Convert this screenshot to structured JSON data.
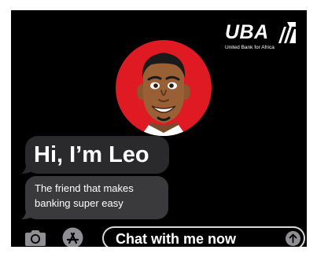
{
  "brand": {
    "name": "UBA",
    "tagline": "United Bank for Africa"
  },
  "messages": {
    "greeting": "Hi, I’m Leo",
    "subtext_line1": "The friend that makes",
    "subtext_line2": "banking super easy"
  },
  "input_bar": {
    "camera_icon": "camera-icon",
    "appstore_icon": "app-store-icon",
    "chat_placeholder": "Chat with me now",
    "send_icon": "arrow-up-icon"
  },
  "colors": {
    "background": "#000000",
    "avatar_red": "#e01a22",
    "bubble_gray": "#2a2a2c",
    "bubble_gray_light": "#3a3a3c",
    "send_button": "#8e8e93"
  }
}
